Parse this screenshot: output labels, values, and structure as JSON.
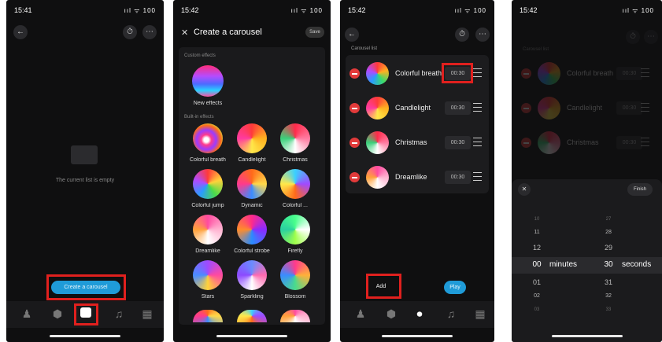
{
  "phone1": {
    "status_time": "15:41",
    "status_icons": "ııl ᯤ 100",
    "empty_text": "The current list is empty",
    "create_button": "Create a carousel"
  },
  "phone2": {
    "status_time": "15:42",
    "status_icons": "ııl ᯤ 100",
    "title": "Create a carousel",
    "save": "Save",
    "custom_heading": "Custom effects",
    "new_effects": "New effects",
    "builtin_heading": "Built-in effects",
    "effects": [
      "Colorful breath",
      "Candlelight",
      "Christmas",
      "Colorful jump",
      "Dynamic",
      "Colorful ...",
      "Dreamlike",
      "Colorful strobe",
      "Firefly",
      "Stars",
      "Sparkling",
      "Blossom"
    ]
  },
  "phone3": {
    "status_time": "15:42",
    "status_icons": "ııl ᯤ 100",
    "list_heading": "Carousel list",
    "items": [
      {
        "name": "Colorful breath",
        "duration": "00:30"
      },
      {
        "name": "Candlelight",
        "duration": "00:30"
      },
      {
        "name": "Christmas",
        "duration": "00:30"
      },
      {
        "name": "Dreamlike",
        "duration": "00:30"
      }
    ],
    "add": "Add",
    "play": "Play"
  },
  "phone4": {
    "status_time": "15:42",
    "status_icons": "ııl ᯤ 100",
    "list_heading": "Carousel list",
    "items": [
      {
        "name": "Colorful breath",
        "duration": "00:30"
      },
      {
        "name": "Candlelight",
        "duration": "00:30"
      },
      {
        "name": "Christmas",
        "duration": "00:30"
      }
    ],
    "finish": "Finish",
    "minutes_label": "minutes",
    "seconds_label": "seconds",
    "minutes": [
      "10",
      "11",
      "12",
      "00",
      "01",
      "02",
      "03"
    ],
    "seconds": [
      "27",
      "28",
      "29",
      "30",
      "31",
      "32",
      "33"
    ]
  },
  "colors": {
    "background": "#0f0f10",
    "accent": "#1f9bd8",
    "highlight": "#e0201e",
    "remove": "#e23a3a"
  }
}
